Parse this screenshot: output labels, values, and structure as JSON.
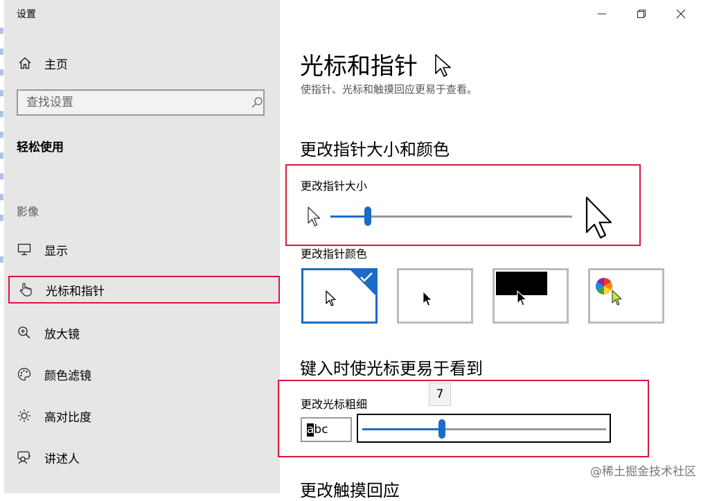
{
  "window": {
    "title": "设置",
    "controls": [
      "minimize-icon",
      "restore-icon",
      "close-icon"
    ]
  },
  "sidebar": {
    "home_label": "主页",
    "search_placeholder": "查找设置",
    "section_heading": "轻松使用",
    "group_label": "影像",
    "items": [
      {
        "label": "显示",
        "icon": "monitor-icon"
      },
      {
        "label": "光标和指针",
        "icon": "hand-pointer-icon",
        "selected": true
      },
      {
        "label": "放大镜",
        "icon": "magnifier-icon"
      },
      {
        "label": "颜色滤镜",
        "icon": "palette-icon"
      },
      {
        "label": "高对比度",
        "icon": "sun-icon"
      },
      {
        "label": "讲述人",
        "icon": "narrator-icon"
      }
    ]
  },
  "main": {
    "title": "光标和指针",
    "description": "使指针、光标和触摸回应更易于查看。",
    "pointer_section": {
      "heading": "更改指针大小和颜色",
      "size_label": "更改指针大小",
      "size_level": 0.14,
      "color_label": "更改指针颜色",
      "color_options": [
        "white",
        "black",
        "inverted",
        "custom"
      ],
      "selected_color": "white"
    },
    "cursor_section": {
      "heading": "键入时使光标更易于看到",
      "thickness_label": "更改光标粗细",
      "thickness_value": "7",
      "thickness_level": 0.32,
      "preview_caret": "a",
      "preview_rest": "bc"
    },
    "touch_section": {
      "heading": "更改触摸回应"
    }
  },
  "watermark": "@稀土掘金技术社区",
  "colors": {
    "accent": "#1c6bc4",
    "highlight_red": "#d9173a",
    "sidebar_bg": "#e6e6e6"
  }
}
